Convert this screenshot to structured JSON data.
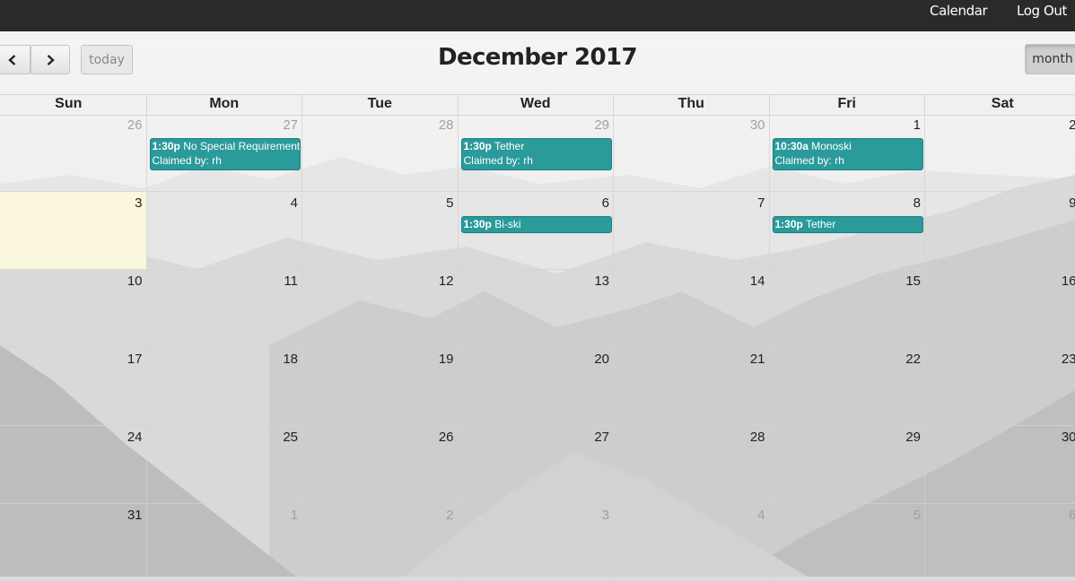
{
  "nav": {
    "calendar": "Calendar",
    "logout": "Log Out"
  },
  "toolbar": {
    "today": "today",
    "month": "month",
    "title": "December 2017"
  },
  "weekdays": [
    "Sun",
    "Mon",
    "Tue",
    "Wed",
    "Thu",
    "Fri",
    "Sat"
  ],
  "weeks": [
    [
      "26",
      "27",
      "28",
      "29",
      "30",
      "1",
      "2"
    ],
    [
      "3",
      "4",
      "5",
      "6",
      "7",
      "8",
      "9"
    ],
    [
      "10",
      "11",
      "12",
      "13",
      "14",
      "15",
      "16"
    ],
    [
      "17",
      "18",
      "19",
      "20",
      "21",
      "22",
      "23"
    ],
    [
      "24",
      "25",
      "26",
      "27",
      "28",
      "29",
      "30"
    ],
    [
      "31",
      "1",
      "2",
      "3",
      "4",
      "5",
      "6"
    ]
  ],
  "other_month_days": {
    "0": [
      0,
      1,
      2,
      3,
      4
    ],
    "5": [
      1,
      2,
      3,
      4,
      5,
      6
    ]
  },
  "today": {
    "week": 1,
    "day": 0
  },
  "events": [
    {
      "week": 0,
      "day": 1,
      "time": "1:30p",
      "title": "No Special Requirements",
      "claimed": "Claimed by: rh"
    },
    {
      "week": 0,
      "day": 3,
      "time": "1:30p",
      "title": "Tether",
      "claimed": "Claimed by: rh"
    },
    {
      "week": 0,
      "day": 5,
      "time": "10:30a",
      "title": "Monoski",
      "claimed": "Claimed by: rh"
    },
    {
      "week": 1,
      "day": 3,
      "time": "1:30p",
      "title": "Bi-ski",
      "claimed": ""
    },
    {
      "week": 1,
      "day": 5,
      "time": "1:30p",
      "title": "Tether",
      "claimed": ""
    }
  ],
  "colors": {
    "event": "#2a9a9a",
    "today": "#fcf8dc",
    "navbar": "#2b2a29"
  },
  "icons": {
    "prev": "chevron-left-icon",
    "next": "chevron-right-icon"
  }
}
